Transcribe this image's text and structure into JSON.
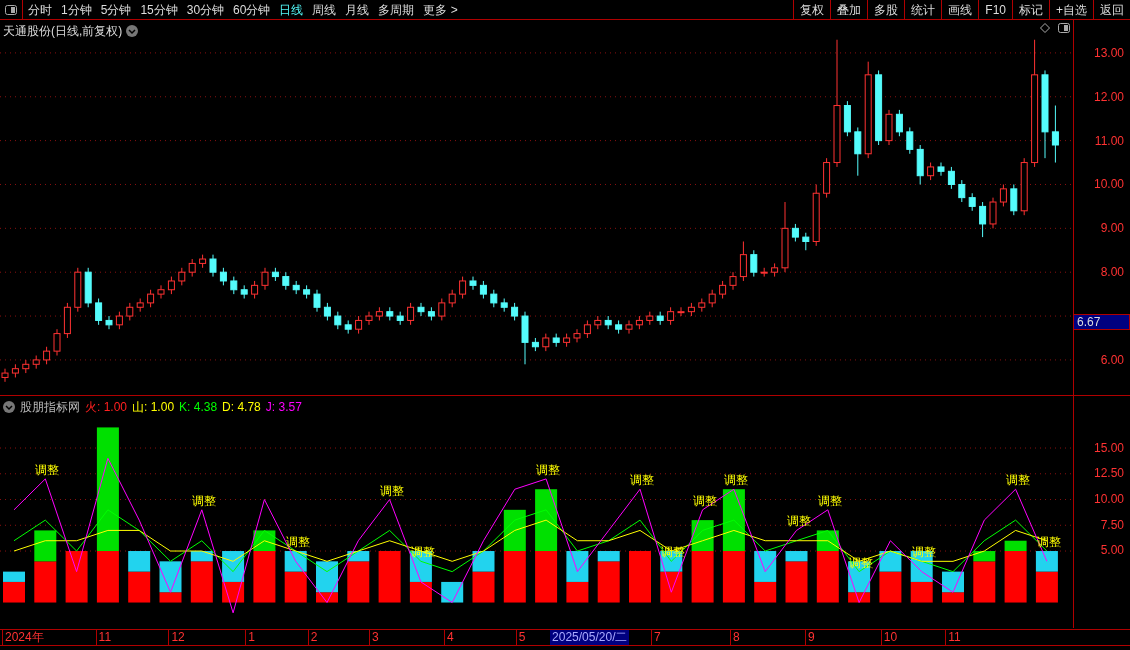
{
  "toolbar": {
    "tabs": [
      {
        "label": "分时",
        "selected": false
      },
      {
        "label": "1分钟",
        "selected": false
      },
      {
        "label": "5分钟",
        "selected": false
      },
      {
        "label": "15分钟",
        "selected": false
      },
      {
        "label": "30分钟",
        "selected": false
      },
      {
        "label": "60分钟",
        "selected": false
      },
      {
        "label": "日线",
        "selected": true
      },
      {
        "label": "周线",
        "selected": false
      },
      {
        "label": "月线",
        "selected": false
      },
      {
        "label": "多周期",
        "selected": false
      },
      {
        "label": "更多 >",
        "selected": false
      }
    ],
    "buttons": [
      "复权",
      "叠加",
      "多股",
      "统计",
      "画线",
      "F10",
      "标记",
      "+自选",
      "返回"
    ]
  },
  "price_panel": {
    "title": "天通股份(日线,前复权)",
    "cursor_price": "6.67",
    "chart_data": {
      "type": "candlestick",
      "grid": true,
      "ylim": [
        5.2,
        13.75
      ],
      "yticks": [
        {
          "value": 6,
          "label": "6.00"
        },
        {
          "value": 8,
          "label": "8.00"
        },
        {
          "value": 9,
          "label": "9.00"
        },
        {
          "value": 10,
          "label": "10.00"
        },
        {
          "value": 11,
          "label": "11.00"
        },
        {
          "value": 12,
          "label": "12.00"
        },
        {
          "value": 13,
          "label": "13.00"
        }
      ],
      "ohlc": [
        [
          5.6,
          5.8,
          5.5,
          5.7
        ],
        [
          5.7,
          5.9,
          5.6,
          5.8
        ],
        [
          5.8,
          6.0,
          5.7,
          5.9
        ],
        [
          5.9,
          6.1,
          5.8,
          6.0
        ],
        [
          6.0,
          6.3,
          5.9,
          6.2
        ],
        [
          6.2,
          6.7,
          6.1,
          6.6
        ],
        [
          6.6,
          7.3,
          6.5,
          7.2
        ],
        [
          7.2,
          8.1,
          7.1,
          8.0
        ],
        [
          8.0,
          8.1,
          7.2,
          7.3
        ],
        [
          7.3,
          7.4,
          6.8,
          6.9
        ],
        [
          6.9,
          7.0,
          6.7,
          6.8
        ],
        [
          6.8,
          7.1,
          6.7,
          7.0
        ],
        [
          7.0,
          7.3,
          6.9,
          7.2
        ],
        [
          7.2,
          7.4,
          7.1,
          7.3
        ],
        [
          7.3,
          7.6,
          7.2,
          7.5
        ],
        [
          7.5,
          7.7,
          7.4,
          7.6
        ],
        [
          7.6,
          7.9,
          7.5,
          7.8
        ],
        [
          7.8,
          8.1,
          7.7,
          8.0
        ],
        [
          8.0,
          8.3,
          7.9,
          8.2
        ],
        [
          8.2,
          8.4,
          8.1,
          8.3
        ],
        [
          8.3,
          8.4,
          7.9,
          8.0
        ],
        [
          8.0,
          8.1,
          7.7,
          7.8
        ],
        [
          7.8,
          7.9,
          7.5,
          7.6
        ],
        [
          7.6,
          7.7,
          7.4,
          7.5
        ],
        [
          7.5,
          7.8,
          7.4,
          7.7
        ],
        [
          7.7,
          8.1,
          7.6,
          8.0
        ],
        [
          8.0,
          8.1,
          7.8,
          7.9
        ],
        [
          7.9,
          8.0,
          7.6,
          7.7
        ],
        [
          7.7,
          7.8,
          7.5,
          7.6
        ],
        [
          7.6,
          7.7,
          7.4,
          7.5
        ],
        [
          7.5,
          7.6,
          7.1,
          7.2
        ],
        [
          7.2,
          7.3,
          6.9,
          7.0
        ],
        [
          7.0,
          7.1,
          6.7,
          6.8
        ],
        [
          6.8,
          6.9,
          6.6,
          6.7
        ],
        [
          6.7,
          7.0,
          6.6,
          6.9
        ],
        [
          6.9,
          7.1,
          6.8,
          7.0
        ],
        [
          7.0,
          7.2,
          6.9,
          7.1
        ],
        [
          7.1,
          7.2,
          6.9,
          7.0
        ],
        [
          7.0,
          7.1,
          6.8,
          6.9
        ],
        [
          6.9,
          7.3,
          6.8,
          7.2
        ],
        [
          7.2,
          7.3,
          7.0,
          7.1
        ],
        [
          7.1,
          7.2,
          6.9,
          7.0
        ],
        [
          7.0,
          7.4,
          6.9,
          7.3
        ],
        [
          7.3,
          7.6,
          7.2,
          7.5
        ],
        [
          7.5,
          7.9,
          7.4,
          7.8
        ],
        [
          7.8,
          7.9,
          7.6,
          7.7
        ],
        [
          7.7,
          7.8,
          7.4,
          7.5
        ],
        [
          7.5,
          7.6,
          7.2,
          7.3
        ],
        [
          7.3,
          7.4,
          7.1,
          7.2
        ],
        [
          7.2,
          7.3,
          6.9,
          7.0
        ],
        [
          7.0,
          7.1,
          5.9,
          6.4
        ],
        [
          6.4,
          6.5,
          6.2,
          6.3
        ],
        [
          6.3,
          6.6,
          6.2,
          6.5
        ],
        [
          6.5,
          6.6,
          6.3,
          6.4
        ],
        [
          6.4,
          6.6,
          6.3,
          6.5
        ],
        [
          6.5,
          6.7,
          6.4,
          6.6
        ],
        [
          6.6,
          6.9,
          6.5,
          6.8
        ],
        [
          6.8,
          7.0,
          6.7,
          6.9
        ],
        [
          6.9,
          7.0,
          6.7,
          6.8
        ],
        [
          6.8,
          6.9,
          6.6,
          6.7
        ],
        [
          6.7,
          6.9,
          6.6,
          6.8
        ],
        [
          6.8,
          7.0,
          6.7,
          6.9
        ],
        [
          6.9,
          7.1,
          6.8,
          7.0
        ],
        [
          7.0,
          7.1,
          6.8,
          6.9
        ],
        [
          6.9,
          7.2,
          6.8,
          7.1
        ],
        [
          7.1,
          7.2,
          7.0,
          7.1
        ],
        [
          7.1,
          7.3,
          7.0,
          7.2
        ],
        [
          7.2,
          7.4,
          7.1,
          7.3
        ],
        [
          7.3,
          7.6,
          7.2,
          7.5
        ],
        [
          7.5,
          7.8,
          7.4,
          7.7
        ],
        [
          7.7,
          8.0,
          7.6,
          7.9
        ],
        [
          7.9,
          8.7,
          7.8,
          8.4
        ],
        [
          8.4,
          8.5,
          7.9,
          8.0
        ],
        [
          8.0,
          8.1,
          7.9,
          8.0
        ],
        [
          8.0,
          8.2,
          7.9,
          8.1
        ],
        [
          8.1,
          9.6,
          8.0,
          9.0
        ],
        [
          9.0,
          9.1,
          8.7,
          8.8
        ],
        [
          8.8,
          8.9,
          8.5,
          8.7
        ],
        [
          8.7,
          10.0,
          8.6,
          9.8
        ],
        [
          9.8,
          10.6,
          9.7,
          10.5
        ],
        [
          10.5,
          13.3,
          10.4,
          11.8
        ],
        [
          11.8,
          11.9,
          11.1,
          11.2
        ],
        [
          11.2,
          11.3,
          10.2,
          10.7
        ],
        [
          10.7,
          12.8,
          10.6,
          12.5
        ],
        [
          12.5,
          12.6,
          10.9,
          11.0
        ],
        [
          11.0,
          11.7,
          10.9,
          11.6
        ],
        [
          11.6,
          11.7,
          11.1,
          11.2
        ],
        [
          11.2,
          11.3,
          10.7,
          10.8
        ],
        [
          10.8,
          10.9,
          10.0,
          10.2
        ],
        [
          10.2,
          10.5,
          10.1,
          10.4
        ],
        [
          10.4,
          10.5,
          10.2,
          10.3
        ],
        [
          10.3,
          10.4,
          9.9,
          10.0
        ],
        [
          10.0,
          10.1,
          9.6,
          9.7
        ],
        [
          9.7,
          9.8,
          9.4,
          9.5
        ],
        [
          9.5,
          9.6,
          8.8,
          9.1
        ],
        [
          9.1,
          9.7,
          9.0,
          9.6
        ],
        [
          9.6,
          10.0,
          9.5,
          9.9
        ],
        [
          9.9,
          10.0,
          9.3,
          9.4
        ],
        [
          9.4,
          10.6,
          9.3,
          10.5
        ],
        [
          10.5,
          13.3,
          10.4,
          12.5
        ],
        [
          12.5,
          12.6,
          10.6,
          11.2
        ],
        [
          11.2,
          11.8,
          10.5,
          10.9
        ]
      ]
    }
  },
  "indicator_panel": {
    "title": "股朋指标网",
    "legend": [
      {
        "label": "火:",
        "value": "1.00",
        "color": "#ff2020"
      },
      {
        "label": "山:",
        "value": "1.00",
        "color": "#ffff00"
      },
      {
        "label": "K:",
        "value": "4.38",
        "color": "#00ff00"
      },
      {
        "label": "D:",
        "value": "4.78",
        "color": "#ffff00"
      },
      {
        "label": "J:",
        "value": "3.57",
        "color": "#ff00ff"
      }
    ],
    "chart_data": {
      "type": "bar",
      "stacked": true,
      "grid": true,
      "ylim": [
        -2.57,
        20.05
      ],
      "yticks": [
        {
          "value": 5,
          "label": "5.00"
        },
        {
          "value": 7.5,
          "label": "7.50"
        },
        {
          "value": 10,
          "label": "10.00"
        },
        {
          "value": 12.5,
          "label": "12.50"
        },
        {
          "value": 15,
          "label": "15.00"
        }
      ],
      "series": [
        {
          "color": "#ff0000",
          "values": [
            2,
            4,
            5,
            5,
            3,
            1,
            4,
            2,
            5,
            3,
            1,
            4,
            5,
            2,
            0,
            3,
            5,
            5,
            2,
            4,
            5,
            3,
            5,
            5,
            2,
            4,
            5,
            1,
            3,
            2,
            1,
            4,
            5,
            3
          ]
        },
        {
          "color": "#00e000",
          "values": [
            0,
            3,
            0,
            12,
            0,
            0,
            0,
            0,
            2,
            0,
            0,
            0,
            0,
            0,
            0,
            0,
            4,
            6,
            0,
            0,
            0,
            0,
            3,
            6,
            0,
            0,
            2,
            0,
            0,
            0,
            0,
            1,
            1,
            0
          ]
        },
        {
          "color": "#22d3ee",
          "values": [
            1,
            0,
            0,
            0,
            2,
            3,
            1,
            3,
            0,
            2,
            3,
            1,
            0,
            3,
            2,
            2,
            0,
            0,
            3,
            1,
            0,
            2,
            0,
            0,
            3,
            1,
            0,
            3,
            2,
            3,
            2,
            0,
            0,
            2
          ]
        },
        {
          "type": "line",
          "color": "#00ff00",
          "values": [
            6,
            8,
            5,
            9,
            7,
            4,
            6,
            3,
            7,
            5,
            3,
            5,
            7,
            4,
            3,
            5,
            8,
            9,
            5,
            6,
            8,
            4,
            7,
            8,
            5,
            6,
            7,
            3,
            5,
            4,
            3,
            6,
            8,
            5
          ]
        },
        {
          "type": "line",
          "color": "#ffff00",
          "values": [
            5,
            6,
            6,
            7,
            7,
            5,
            5,
            4,
            6,
            5,
            4,
            5,
            6,
            5,
            4,
            5,
            7,
            8,
            6,
            6,
            7,
            5,
            6,
            7,
            6,
            6,
            6,
            4,
            5,
            4,
            4,
            5,
            7,
            6
          ]
        },
        {
          "type": "line",
          "color": "#ff00ff",
          "values": [
            9,
            12,
            3,
            14,
            8,
            1,
            9,
            -1,
            10,
            4,
            0,
            6,
            10,
            2,
            0,
            6,
            11,
            12,
            3,
            7,
            11,
            1,
            9,
            11,
            3,
            7,
            9,
            0,
            6,
            3,
            1,
            8,
            11,
            4
          ]
        }
      ],
      "annotations": [
        "调整",
        "调整",
        "调整",
        "调整",
        "调整",
        "调整",
        "调整",
        "调整",
        "调整",
        "调整",
        "调整",
        "调整",
        "调整",
        "调整",
        "调整",
        "调整"
      ]
    }
  },
  "time_axis": {
    "labels": [
      "2024年",
      "11",
      "12",
      "1",
      "2",
      "3",
      "4",
      "5",
      "7",
      "8",
      "9",
      "10",
      "11"
    ],
    "cursor_date": "2025/05/20/二"
  }
}
